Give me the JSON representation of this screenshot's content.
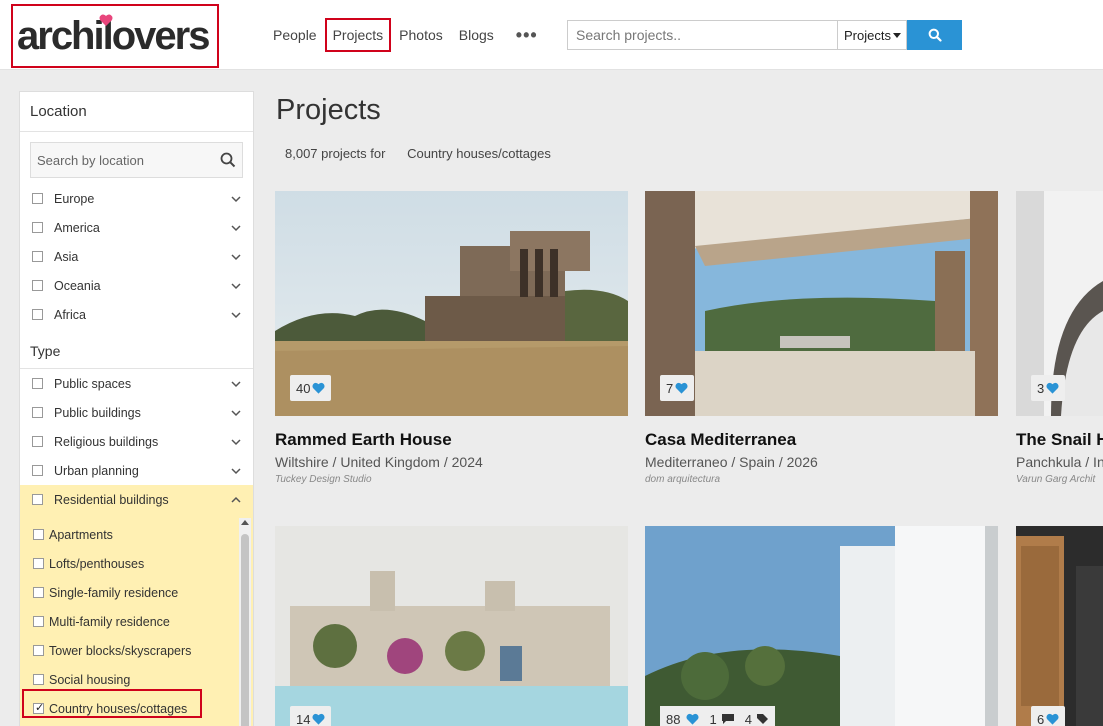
{
  "header": {
    "logo_text": "archilovers",
    "nav": [
      {
        "label": "People"
      },
      {
        "label": "Projects"
      },
      {
        "label": "Photos"
      },
      {
        "label": "Blogs"
      }
    ],
    "more_label": "•••",
    "search_placeholder": "Search projects..",
    "search_scope": "Projects"
  },
  "sidebar": {
    "location_heading": "Location",
    "location_search_placeholder": "Search by location",
    "regions": [
      "Europe",
      "America",
      "Asia",
      "Oceania",
      "Africa"
    ],
    "type_heading": "Type",
    "types": [
      "Public spaces",
      "Public buildings",
      "Religious buildings",
      "Urban planning"
    ],
    "residential_label": "Residential buildings",
    "residential_sub": [
      {
        "label": "Apartments",
        "checked": false
      },
      {
        "label": "Lofts/penthouses",
        "checked": false
      },
      {
        "label": "Single-family residence",
        "checked": false
      },
      {
        "label": "Multi-family residence",
        "checked": false
      },
      {
        "label": "Tower blocks/skyscrapers",
        "checked": false
      },
      {
        "label": "Social housing",
        "checked": false
      },
      {
        "label": "Country houses/cottages",
        "checked": true
      }
    ]
  },
  "main": {
    "title": "Projects",
    "count_text": "8,007 projects for",
    "category_text": "Country houses/cottages",
    "cards": [
      {
        "likes": "40",
        "title": "Rammed Earth House",
        "location": "Wiltshire / United Kingdom / 2024",
        "studio": "Tuckey Design Studio"
      },
      {
        "likes": "7",
        "title": "Casa Mediterranea",
        "location": "Mediterraneo / Spain / 2026",
        "studio": "dom arquitectura"
      },
      {
        "likes": "3",
        "title": "The Snail H",
        "location": "Panchkula / Indi",
        "studio": "Varun Garg Archit"
      },
      {
        "likes": "14"
      },
      {
        "likes": "88",
        "comments": "1",
        "tags": "4"
      },
      {
        "likes": "6"
      }
    ]
  },
  "colors": {
    "accent_blue": "#2a93d5",
    "highlight_red": "#d0021b",
    "filter_yellow": "#fff0b3"
  }
}
